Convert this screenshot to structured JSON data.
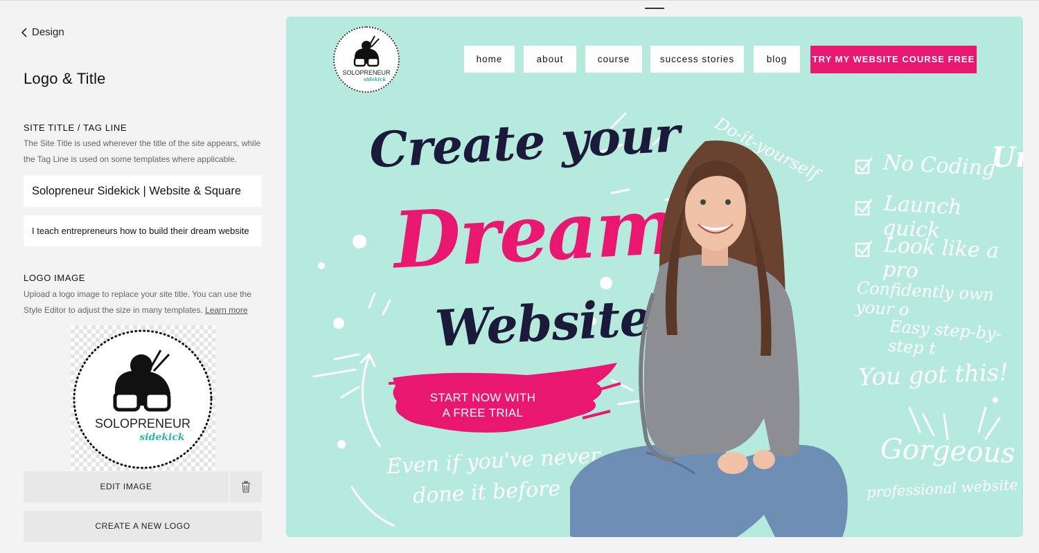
{
  "panel": {
    "back_label": "Design",
    "title": "Logo & Title",
    "site_title_section": {
      "label": "SITE TITLE / TAG LINE",
      "help_line1": "The Site Title is used wherever the title of the site appears, while",
      "help_line2": "the Tag Line is used on some templates where applicable.",
      "title_value": "Solopreneur Sidekick | Website & Square",
      "tagline_value": "I teach entrepreneurs how to build their dream website"
    },
    "logo_section": {
      "label": "LOGO IMAGE",
      "help_line1": "Upload a logo image to replace your site title. You can use the",
      "help_line2": "Style Editor to adjust the size in many templates.",
      "learn_more": "Learn more",
      "logo_text_main": "SOLOPRENEUR",
      "logo_text_sub": "sidekick"
    },
    "edit_image_label": "EDIT IMAGE",
    "create_logo_label": "CREATE A NEW LOGO"
  },
  "preview": {
    "logo_text_main": "SOLOPRENEUR",
    "logo_text_sub": "sidekick",
    "nav": [
      "home",
      "about",
      "course",
      "success stories",
      "blog"
    ],
    "nav_cta": "TRY MY WEBSITE COURSE FREE",
    "hero_line1": "Create your",
    "hero_line2": "Dream",
    "hero_line3": "Website",
    "cta_line1": "START NOW WITH",
    "cta_line2": "A FREE TRIAL",
    "note_line1": "Even if you've never",
    "note_line2": "done it before",
    "diy": "Do-it-yourself",
    "checklist": [
      "No Coding",
      "Launch quick",
      "Look like a pro"
    ],
    "side_lines": [
      "Confidently own your o",
      "Easy step-by-step t",
      "You got this!"
    ],
    "gorgeous": "Gorgeous",
    "gorgeous_sub": "professional website",
    "edge_fragment": "Un"
  },
  "colors": {
    "mint": "#b5eadd",
    "pink": "#e8176f",
    "navy": "#1b1a3a",
    "teal_accent": "#2bb8a4"
  }
}
